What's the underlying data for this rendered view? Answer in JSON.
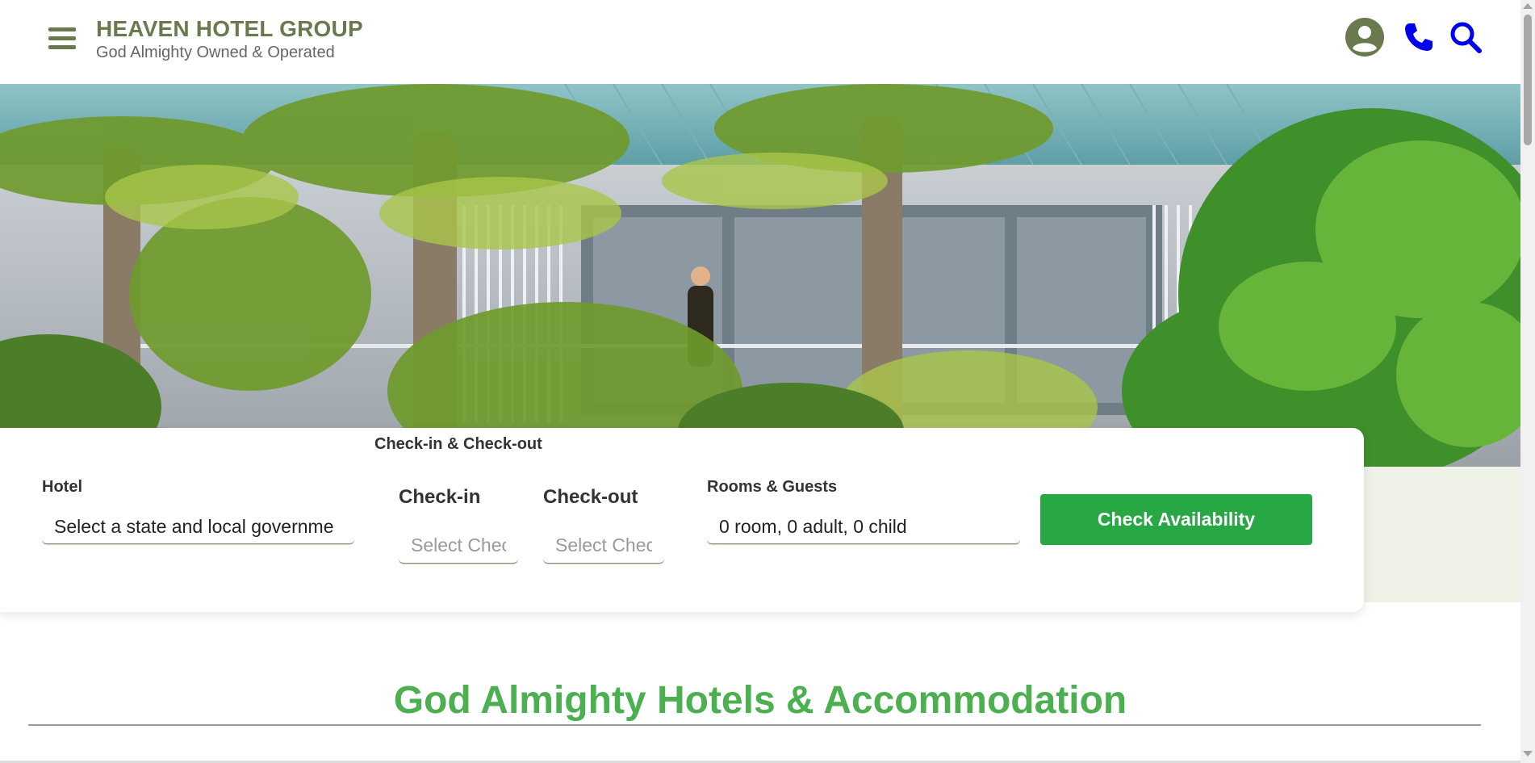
{
  "header": {
    "brand_title": "HEAVEN HOTEL GROUP",
    "brand_subtitle": "God Almighty Owned & Operated",
    "icons": [
      "menu-icon",
      "user-icon",
      "phone-icon",
      "search-icon"
    ]
  },
  "booking": {
    "group_label": "Check-in & Check-out",
    "hotel_label": "Hotel",
    "hotel_value": "Select a state and local governme",
    "checkin_label": "Check-in",
    "checkin_placeholder": "Select Check-in",
    "checkout_label": "Check-out",
    "checkout_placeholder": "Select Check-out",
    "rooms_label": "Rooms & Guests",
    "rooms_value": "0 room, 0 adult, 0 child",
    "button_label": "Check Availability"
  },
  "section": {
    "title": "God Almighty Hotels & Accommodation"
  },
  "colors": {
    "brand_olive": "#6b7a4e",
    "accent_green": "#28a745",
    "heading_green": "#4caf50",
    "icon_blue": "#0000ee"
  }
}
